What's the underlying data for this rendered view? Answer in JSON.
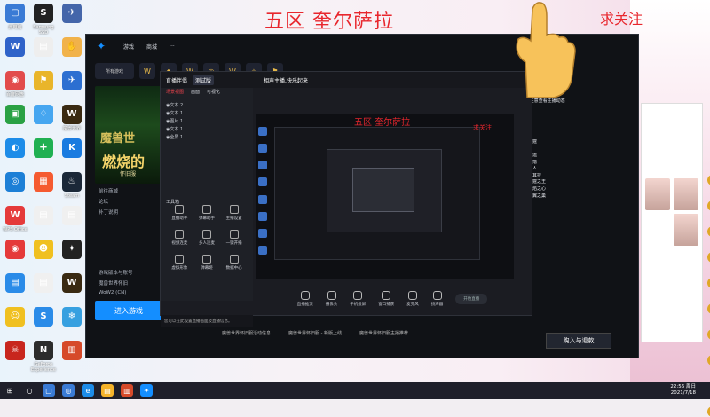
{
  "overlay": {
    "title": "五区 奎尔萨拉",
    "follow": "求关注"
  },
  "desktop_icons": [
    {
      "label": "此电脑",
      "color": "#3a7bd5",
      "glyph": "▢"
    },
    {
      "label": "Samsung SSD",
      "color": "#222",
      "glyph": "S"
    },
    {
      "label": "",
      "color": "#4466aa",
      "glyph": "✈"
    },
    {
      "label": "",
      "color": "#2f63c9",
      "glyph": "W"
    },
    {
      "label": "",
      "color": "#eeeeee",
      "glyph": "▤"
    },
    {
      "label": "",
      "color": "#f1b24a",
      "glyph": "✋"
    },
    {
      "label": "百度网盘",
      "color": "#e24b4b",
      "glyph": "◉"
    },
    {
      "label": "",
      "color": "#e9b52a",
      "glyph": "⚑"
    },
    {
      "label": "",
      "color": "#2c6fd1",
      "glyph": "✈"
    },
    {
      "label": "",
      "color": "#2aa144",
      "glyph": "▣"
    },
    {
      "label": "",
      "color": "#46a6f0",
      "glyph": "♢"
    },
    {
      "label": "魔兽世界",
      "color": "#3a2a12",
      "glyph": "W"
    },
    {
      "label": "",
      "color": "#1d8ce8",
      "glyph": "◐"
    },
    {
      "label": "",
      "color": "#20b052",
      "glyph": "✚"
    },
    {
      "label": "",
      "color": "#1a7be0",
      "glyph": "K"
    },
    {
      "label": "",
      "color": "#1c7fd6",
      "glyph": "◎"
    },
    {
      "label": "",
      "color": "#f55a30",
      "glyph": "▦"
    },
    {
      "label": "Steam",
      "color": "#1b2838",
      "glyph": "♨"
    },
    {
      "label": "WPS Office",
      "color": "#e53a3a",
      "glyph": "W"
    },
    {
      "label": "",
      "color": "#f0f0f0",
      "glyph": "▤"
    },
    {
      "label": "",
      "color": "#f0f0f0",
      "glyph": "▤"
    },
    {
      "label": "",
      "color": "#e53a3a",
      "glyph": "◉"
    },
    {
      "label": "",
      "color": "#f0c020",
      "glyph": "☻"
    },
    {
      "label": "",
      "color": "#222",
      "glyph": "✦"
    },
    {
      "label": "",
      "color": "#2a8be8",
      "glyph": "▤"
    },
    {
      "label": "",
      "color": "#f0f0f0",
      "glyph": "▤"
    },
    {
      "label": "",
      "color": "#3a2a12",
      "glyph": "W"
    },
    {
      "label": "",
      "color": "#f0c020",
      "glyph": "☺"
    },
    {
      "label": "",
      "color": "#2a8be8",
      "glyph": "S"
    },
    {
      "label": "",
      "color": "#37a0e0",
      "glyph": "❄"
    },
    {
      "label": "",
      "color": "#c8261e",
      "glyph": "☠"
    },
    {
      "label": "GeForce Experience",
      "color": "#2c2c2c",
      "glyph": "N"
    },
    {
      "label": "",
      "color": "#d64a2a",
      "glyph": "▥"
    }
  ],
  "battlenet": {
    "tabs": [
      "游戏",
      "商城",
      "···"
    ],
    "all_games": "所有游戏",
    "banner": {
      "line1": "魔兽世",
      "line2": "燃烧的",
      "line3": "怀旧服"
    },
    "links": [
      "前往商城",
      "论坛",
      "补丁说明"
    ],
    "region_label": "游戏版本与账号",
    "account": "魔兽世界怀旧",
    "version": "WoW2 (CN)",
    "play_button": "进入游戏",
    "install_button": "购入与退款",
    "version_num": "版本: 2.5.1.38879"
  },
  "obs": {
    "app_name": "直播伴侣",
    "tag": "测试版",
    "host": "相声主播,快乐起来",
    "tabs": [
      "场景视图",
      "画面",
      "可视化"
    ],
    "layers": [
      "文本 2",
      "文本 1",
      "图片 1",
      "文本 1",
      "全屏 1"
    ],
    "tools_label": "工具箱",
    "tools": [
      "直播助手",
      "弹幕助手",
      "主播设置",
      "视频连麦",
      "多人连麦",
      "一键开播",
      "虚拟形象",
      "弹幕姬",
      "数据中心"
    ],
    "bottom": [
      "直播推流",
      "摄像头",
      "手机投屏",
      "窗口捕获",
      "麦克风",
      "扬声器"
    ],
    "start_live": "开始直播",
    "notice": "您可以在此设置直播画面及直播信息。"
  },
  "chat": [
    "观众 - 0/1",
    "欢迎来到直播间,请文明发言",
    "新人进入直播间,注意查看主播动态",
    "主播正在直播中",
    "冰清 - 15/45",
    "该区服务器",
    "五区 奎尔萨拉",
    "魔兽世界怀旧",
    "魔兽世界怀旧 - 雷霆",
    "魔兽之魂",
    "魔兽世界怀旧 - 幸运",
    "魔兽世界怀旧 - 部落",
    "魔兽世界怀旧 - 鱼人",
    "魔兽世界怀旧 - 安其拉",
    "魔兽世界怀旧 - 雷霆之王",
    "魔兽世界怀旧 - 火焰之心",
    "魔兽世界怀旧 - 黑翼之巢"
  ],
  "news": [
    "魔兽世界怀旧服活动信息",
    "魔兽世界怀旧服 - 新版上线",
    "魔兽世界怀旧服主播推荐"
  ],
  "taskbar": {
    "time": "22:56 周日",
    "date": "2021/7/18"
  }
}
